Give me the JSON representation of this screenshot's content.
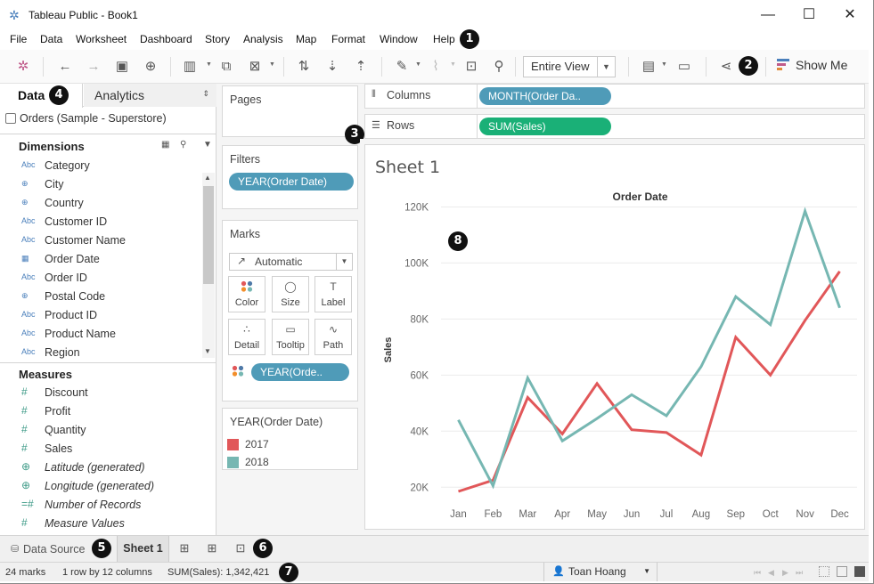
{
  "window": {
    "title": "Tableau Public - Book1",
    "controls": {
      "minimize": "—",
      "maximize": "☐",
      "close": "✕"
    }
  },
  "menu": [
    "File",
    "Data",
    "Worksheet",
    "Dashboard",
    "Story",
    "Analysis",
    "Map",
    "Format",
    "Window",
    "Help"
  ],
  "toolbar": {
    "view_select": "Entire View",
    "show_me": "Show Me"
  },
  "callouts": [
    "1",
    "2",
    "3",
    "4",
    "5",
    "6",
    "7",
    "8"
  ],
  "data_pane": {
    "tabs": {
      "data": "Data",
      "analytics": "Analytics"
    },
    "datasource": "Orders (Sample - Superstore)",
    "dimensions_label": "Dimensions",
    "dimensions": [
      {
        "type": "Abc",
        "name": "Category"
      },
      {
        "type": "globe",
        "name": "City"
      },
      {
        "type": "globe",
        "name": "Country"
      },
      {
        "type": "Abc",
        "name": "Customer ID"
      },
      {
        "type": "Abc",
        "name": "Customer Name"
      },
      {
        "type": "calendar",
        "name": "Order Date"
      },
      {
        "type": "Abc",
        "name": "Order ID"
      },
      {
        "type": "globe",
        "name": "Postal Code"
      },
      {
        "type": "Abc",
        "name": "Product ID"
      },
      {
        "type": "Abc",
        "name": "Product Name"
      },
      {
        "type": "Abc",
        "name": "Region"
      }
    ],
    "measures_label": "Measures",
    "measures": [
      {
        "type": "#",
        "name": "Discount",
        "italic": false
      },
      {
        "type": "#",
        "name": "Profit",
        "italic": false
      },
      {
        "type": "#",
        "name": "Quantity",
        "italic": false
      },
      {
        "type": "#",
        "name": "Sales",
        "italic": false
      },
      {
        "type": "globe",
        "name": "Latitude (generated)",
        "italic": true
      },
      {
        "type": "globe",
        "name": "Longitude (generated)",
        "italic": true
      },
      {
        "type": "=#",
        "name": "Number of Records",
        "italic": true
      },
      {
        "type": "#",
        "name": "Measure Values",
        "italic": true
      }
    ]
  },
  "cards": {
    "pages": "Pages",
    "filters": "Filters",
    "filter_pill": "YEAR(Order Date)",
    "marks": "Marks",
    "mark_type": "Automatic",
    "mark_buttons": [
      {
        "name": "color",
        "label": "Color",
        "icon": "●●"
      },
      {
        "name": "size",
        "label": "Size",
        "icon": "◯"
      },
      {
        "name": "label",
        "label": "Label",
        "icon": "T"
      },
      {
        "name": "detail",
        "label": "Detail",
        "icon": "∴"
      },
      {
        "name": "tooltip",
        "label": "Tooltip",
        "icon": "▭"
      },
      {
        "name": "path",
        "label": "Path",
        "icon": "∿"
      }
    ],
    "marks_pill": "YEAR(Orde..",
    "legend_title": "YEAR(Order Date)",
    "legend": [
      {
        "label": "2017",
        "color": "#e15759"
      },
      {
        "label": "2018",
        "color": "#76b7b2"
      }
    ]
  },
  "shelves": {
    "columns_label": "Columns",
    "columns_pill": "MONTH(Order Da..",
    "rows_label": "Rows",
    "rows_pill": "SUM(Sales)"
  },
  "sheet": {
    "title": "Sheet 1"
  },
  "chart_data": {
    "type": "line",
    "title": "Order Date",
    "xlabel": "",
    "ylabel": "Sales",
    "categories": [
      "Jan",
      "Feb",
      "Mar",
      "Apr",
      "May",
      "Jun",
      "Jul",
      "Aug",
      "Sep",
      "Oct",
      "Nov",
      "Dec"
    ],
    "ylim": [
      15000,
      123000
    ],
    "yticks": [
      20000,
      40000,
      60000,
      80000,
      100000,
      120000
    ],
    "ytick_labels": [
      "20K",
      "40K",
      "60K",
      "80K",
      "100K",
      "120K"
    ],
    "grid": true,
    "series": [
      {
        "name": "2017",
        "color": "#e15759",
        "values": [
          18500,
          22500,
          52000,
          39000,
          57000,
          40500,
          39500,
          31500,
          73500,
          60000,
          79500,
          97000
        ]
      },
      {
        "name": "2018",
        "color": "#76b7b2",
        "values": [
          44000,
          20500,
          59000,
          36500,
          44500,
          53000,
          45500,
          63000,
          88000,
          78000,
          118500,
          84000
        ]
      }
    ]
  },
  "sheet_tabs": {
    "data_source": "Data Source",
    "active": "Sheet 1"
  },
  "status": {
    "marks": "24 marks",
    "dims": "1 row by 12 columns",
    "sum": "SUM(Sales): 1,342,421",
    "user": "Toan Hoang"
  }
}
